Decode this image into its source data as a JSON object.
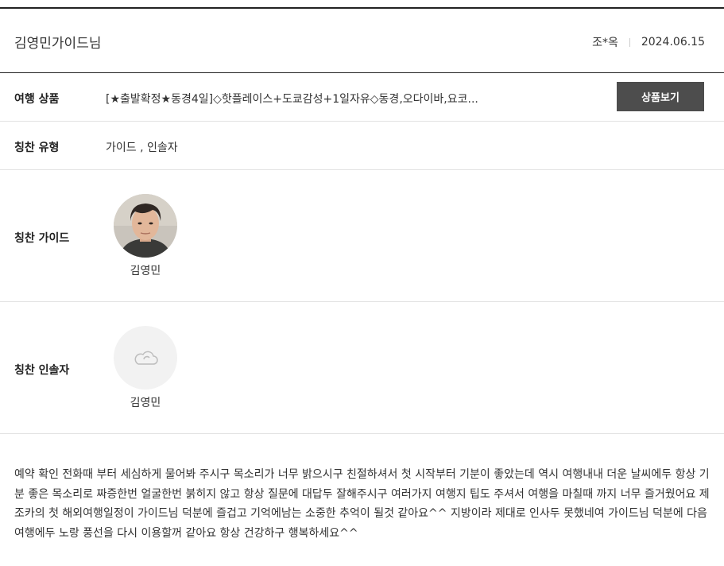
{
  "header": {
    "title": "김영민가이드님",
    "author": "조*옥",
    "date": "2024.06.15"
  },
  "product": {
    "label": "여행 상품",
    "name": "[★출발확정★동경4일]◇핫플레이스+도쿄감성+1일자유◇동경,오다이바,요코...",
    "button_label": "상품보기"
  },
  "praise_type": {
    "label": "칭찬 유형",
    "value": "가이드 , 인솔자"
  },
  "guide": {
    "label": "칭찬 가이드",
    "name": "김영민"
  },
  "escort": {
    "label": "칭찬 인솔자",
    "name": "김영민",
    "icon": "cloud-icon"
  },
  "review": {
    "text": "예약 확인 전화때 부터 세심하게 물어봐 주시구 목소리가 너무 밝으시구 친절하셔서 첫 시작부터 기분이 좋았는데 역시 여행내내 더운 날씨에두 항상 기분 좋은 목소리로 짜증한번 얼굴한번 붉히지 않고 항상 질문에 대답두 잘해주시구 여러가지 여행지 팁도 주셔서 여행을 마칠때 까지 너무 즐거웠어요 제 조카의 첫 해외여행일정이 가이드님 덕분에 즐겁고 기억에남는 소중한 추억이 될것 같아요^^ 지방이라 제대로 인사두 못했네여 가이드님 덕분에 다음 여행에두 노랑 풍선을 다시 이용할꺼 같아요 항상 건강하구 행복하세요^^"
  },
  "colors": {
    "header_rule": "#222222",
    "button_bg": "#4d4d4d",
    "divider": "#e2e2e2",
    "placeholder_bg": "#f2f2f2"
  }
}
